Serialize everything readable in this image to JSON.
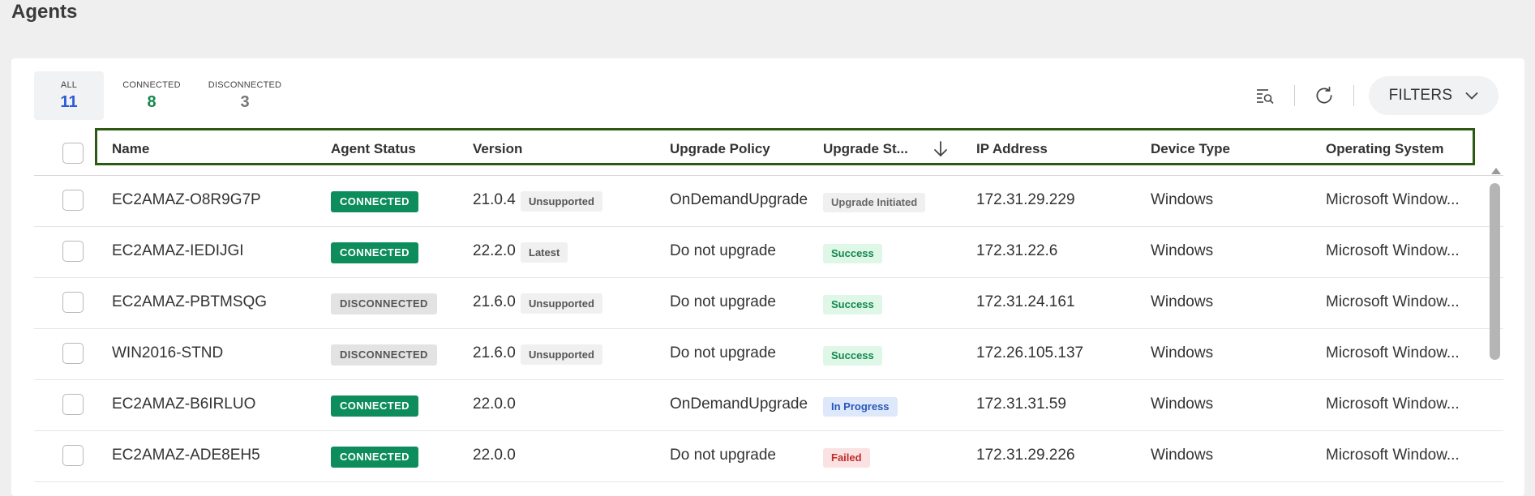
{
  "page": {
    "title": "Agents"
  },
  "tabs": [
    {
      "label": "ALL",
      "count": "11",
      "color": "#2a5bd7"
    },
    {
      "label": "CONNECTED",
      "count": "8",
      "color": "#13884f"
    },
    {
      "label": "DISCONNECTED",
      "count": "3",
      "color": "#777777"
    }
  ],
  "toolbar": {
    "filters_label": "FILTERS"
  },
  "table": {
    "columns": [
      "Name",
      "Agent Status",
      "Version",
      "Upgrade Policy",
      "Upgrade St...",
      "IP Address",
      "Device Type",
      "Operating System"
    ],
    "rows": [
      {
        "name": "EC2AMAZ-O8R9G7P",
        "status": "CONNECTED",
        "version": "21.0.4",
        "version_tag": "Unsupported",
        "policy": "OnDemandUpgrade",
        "upgrade": "Upgrade Initiated",
        "upgrade_kind": "initiated",
        "ip": "172.31.29.229",
        "device": "Windows",
        "os": "Microsoft Window..."
      },
      {
        "name": "EC2AMAZ-IEDIJGI",
        "status": "CONNECTED",
        "version": "22.2.0",
        "version_tag": "Latest",
        "policy": "Do not upgrade",
        "upgrade": "Success",
        "upgrade_kind": "success",
        "ip": "172.31.22.6",
        "device": "Windows",
        "os": "Microsoft Window..."
      },
      {
        "name": "EC2AMAZ-PBTMSQG",
        "status": "DISCONNECTED",
        "version": "21.6.0",
        "version_tag": "Unsupported",
        "policy": "Do not upgrade",
        "upgrade": "Success",
        "upgrade_kind": "success",
        "ip": "172.31.24.161",
        "device": "Windows",
        "os": "Microsoft Window..."
      },
      {
        "name": "WIN2016-STND",
        "status": "DISCONNECTED",
        "version": "21.6.0",
        "version_tag": "Unsupported",
        "policy": "Do not upgrade",
        "upgrade": "Success",
        "upgrade_kind": "success",
        "ip": "172.26.105.137",
        "device": "Windows",
        "os": "Microsoft Window..."
      },
      {
        "name": "EC2AMAZ-B6IRLUO",
        "status": "CONNECTED",
        "version": "22.0.0",
        "version_tag": "",
        "policy": "OnDemandUpgrade",
        "upgrade": "In Progress",
        "upgrade_kind": "progress",
        "ip": "172.31.31.59",
        "device": "Windows",
        "os": "Microsoft Window..."
      },
      {
        "name": "EC2AMAZ-ADE8EH5",
        "status": "CONNECTED",
        "version": "22.0.0",
        "version_tag": "",
        "policy": "Do not upgrade",
        "upgrade": "Failed",
        "upgrade_kind": "failed",
        "ip": "172.31.29.226",
        "device": "Windows",
        "os": "Microsoft Window..."
      }
    ]
  },
  "icons": {
    "search_list": "search-list-icon",
    "refresh": "refresh-icon",
    "chevron": "chevron-down-icon",
    "sort": "arrow-down-icon",
    "scroll_up": "scroll-up-arrow-icon"
  }
}
